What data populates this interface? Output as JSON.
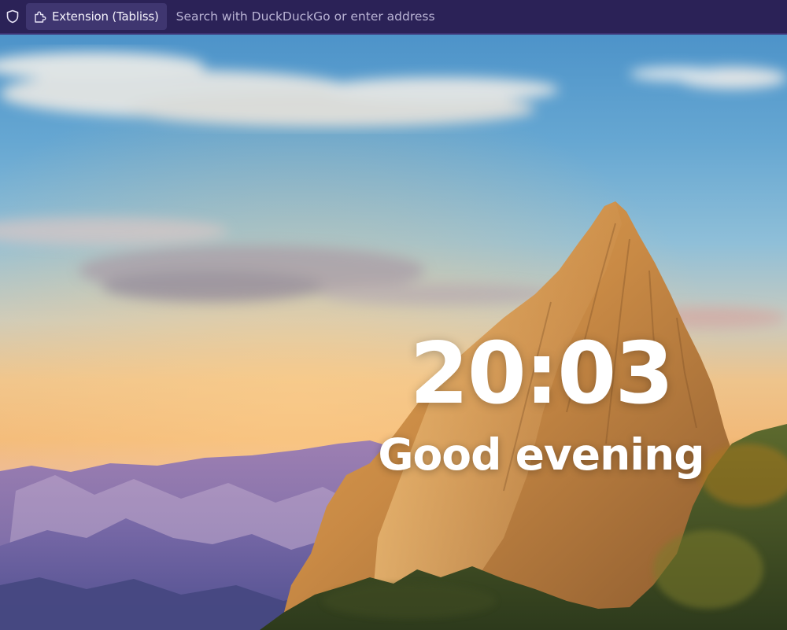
{
  "browser": {
    "identity_label": "Extension (Tabliss)",
    "url_placeholder": "Search with DuckDuckGo or enter address",
    "icons": {
      "tracking_protection": "shield-icon",
      "identity": "extension-puzzle-icon"
    },
    "colors": {
      "toolbar": "#2b2257",
      "identity_box": "#3f3670"
    }
  },
  "newtab": {
    "time": "20:03",
    "greeting": "Good evening"
  }
}
